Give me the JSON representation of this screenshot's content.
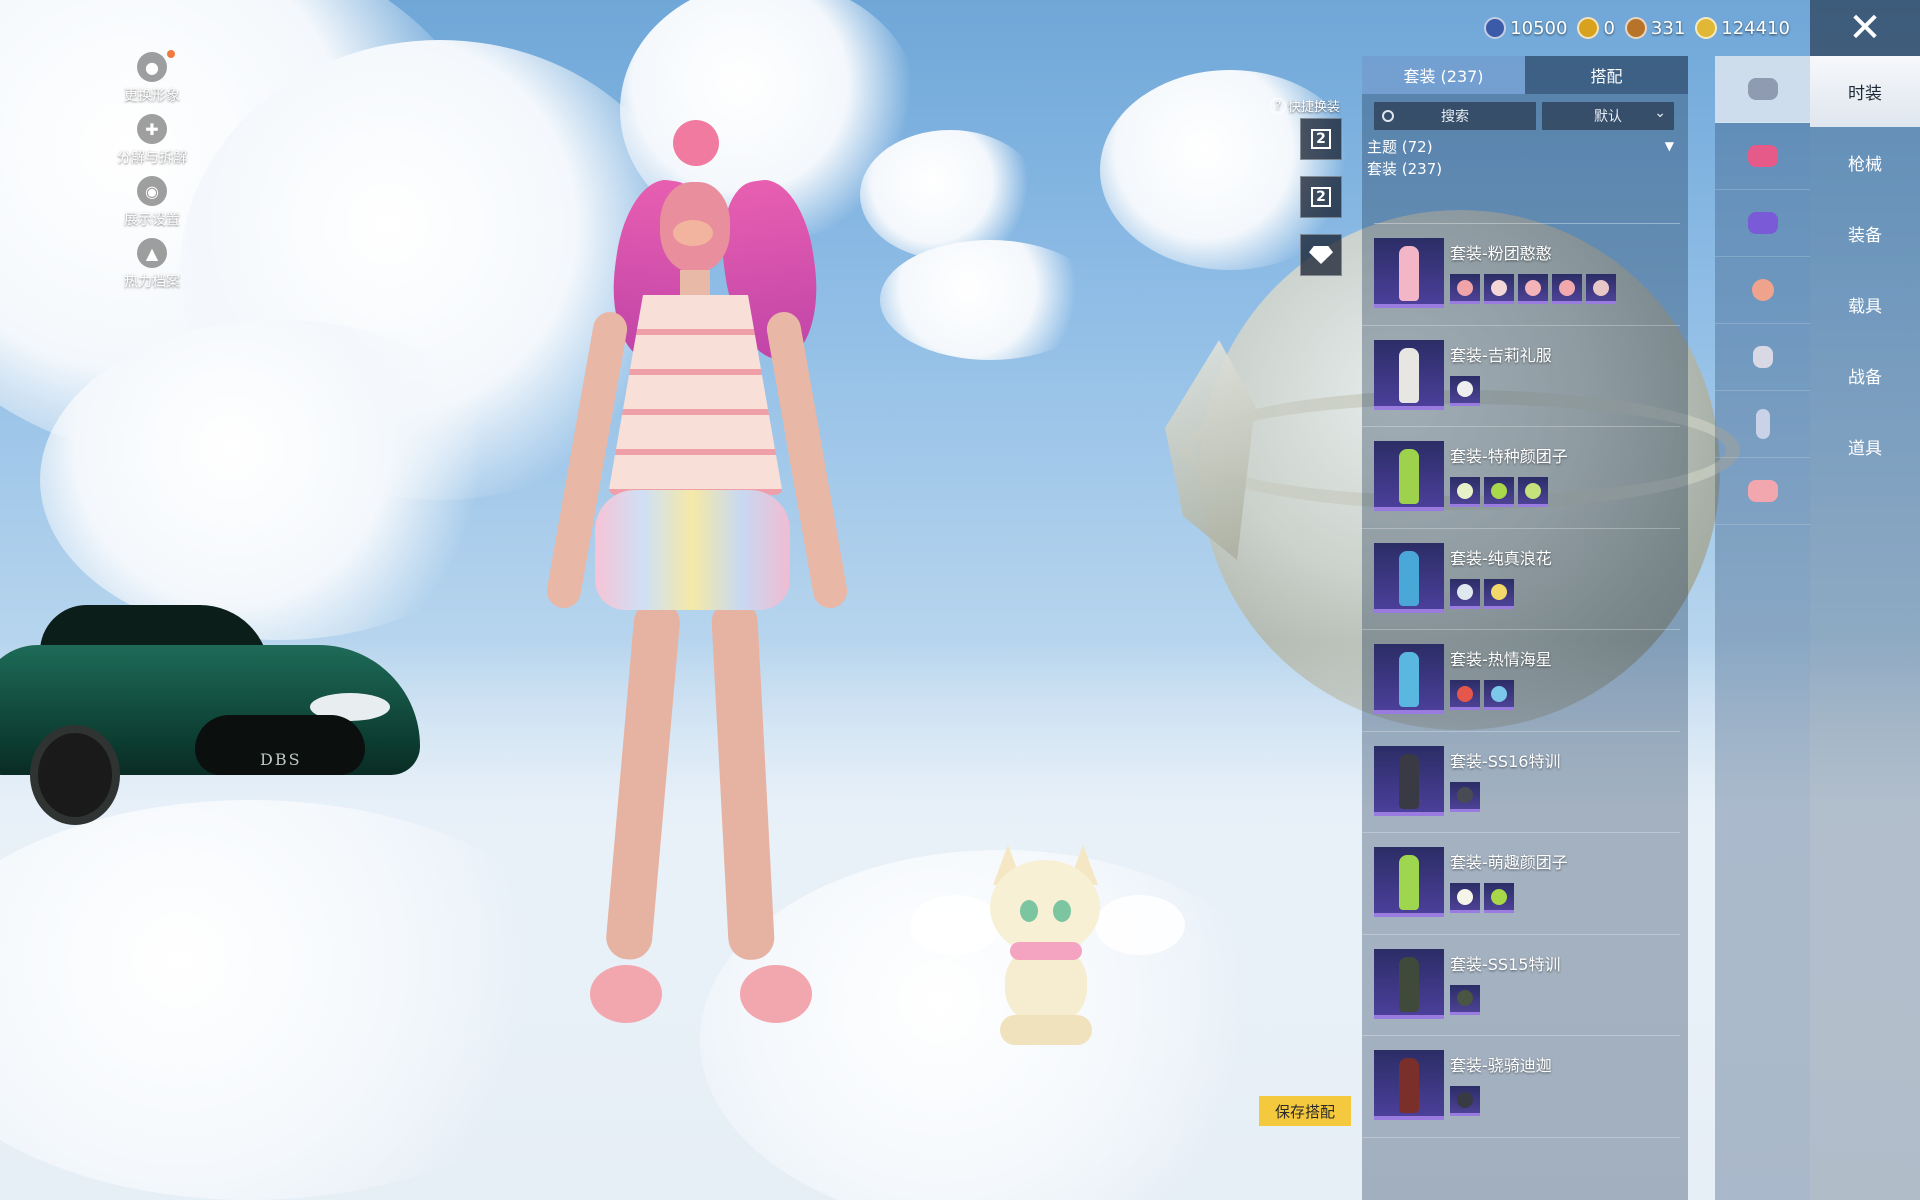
{
  "left_menu": [
    {
      "label": "更换形象",
      "icon": "avatar-icon"
    },
    {
      "label": "分解与拆解",
      "icon": "puzzle-icon"
    },
    {
      "label": "展示设置",
      "icon": "eye-icon"
    },
    {
      "label": "热力档案",
      "icon": "flame-icon"
    }
  ],
  "currency": [
    {
      "value": "10500",
      "icon": "blue-coin-icon",
      "color": "#3b5aa8"
    },
    {
      "value": "0",
      "icon": "ag-coin-icon",
      "color": "#d8a21e"
    },
    {
      "value": "331",
      "icon": "bronze-coin-icon",
      "color": "#b8732a"
    },
    {
      "value": "124410",
      "icon": "bp-coin-icon",
      "color": "#e0b836"
    }
  ],
  "close_label": "✕",
  "categories": [
    "时装",
    "枪械",
    "装备",
    "载具",
    "战备",
    "道具"
  ],
  "icon_nav": [
    {
      "name": "outfit-icon",
      "color": "#dfe5ee"
    },
    {
      "name": "headwear-icon",
      "color": "#e65a8a"
    },
    {
      "name": "glasses-icon",
      "color": "#7b5ad8"
    },
    {
      "name": "mask-icon",
      "color": "#f0a38c"
    },
    {
      "name": "top-icon",
      "color": "#d9d9e6"
    },
    {
      "name": "pants-icon",
      "color": "#c9d2e6"
    },
    {
      "name": "shoes-icon",
      "color": "#f2a7ae"
    }
  ],
  "panel": {
    "tab_suits": "套装 (237)",
    "tab_match": "搭配",
    "search_placeholder": "搜索",
    "sort_value": "默认",
    "theme_label": "主题 (72)",
    "suits_label": "套装 (237)"
  },
  "outfits": [
    {
      "title": "套装-粉团憨憨",
      "color": "#f2b6c6",
      "pieces": [
        "#f0a3a8",
        "#f5d6d6",
        "#f4b2b9",
        "#f1a9ae",
        "#e8c7c7"
      ]
    },
    {
      "title": "套装-吉莉礼服",
      "color": "#e8e6e2",
      "pieces": [
        "#efefef"
      ]
    },
    {
      "title": "套装-特种颜团子",
      "color": "#9ed24c",
      "pieces": [
        "#e8f2c8",
        "#a9d84b",
        "#c6e27a"
      ]
    },
    {
      "title": "套装-纯真浪花",
      "color": "#4aa8d9",
      "pieces": [
        "#e0e8ef",
        "#f2d86b"
      ]
    },
    {
      "title": "套装-热情海星",
      "color": "#5ab8e0",
      "pieces": [
        "#e4574a",
        "#7cc8ea"
      ]
    },
    {
      "title": "套装-SS16特训",
      "color": "#3a3a44",
      "pieces": [
        "#4a4a55"
      ]
    },
    {
      "title": "套装-萌趣颜团子",
      "color": "#9fd64f",
      "pieces": [
        "#f4f4e8",
        "#a8d84a"
      ]
    },
    {
      "title": "套装-SS15特训",
      "color": "#3f4a3a",
      "pieces": [
        "#4a5544"
      ]
    },
    {
      "title": "套装-骁骑迪迦",
      "color": "#7a2f2a",
      "pieces": [
        "#3a3a44"
      ]
    }
  ],
  "quick": {
    "label": "快捷换装",
    "help": "?",
    "slot1_value": "2",
    "slot2_value": "2"
  },
  "save_label": "保存搭配",
  "car_badge": "DBS"
}
